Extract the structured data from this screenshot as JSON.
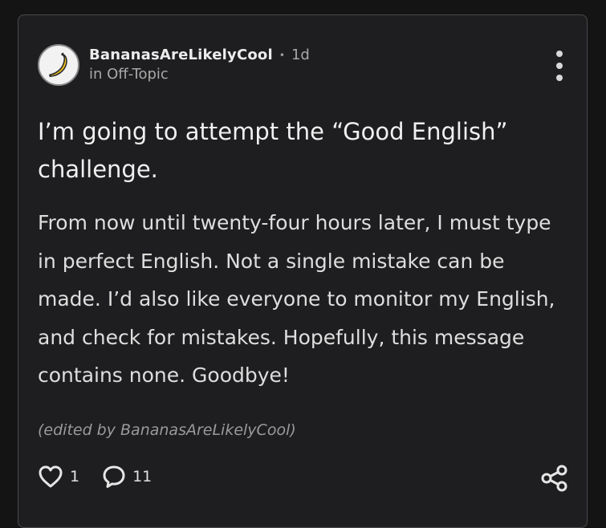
{
  "post": {
    "author": "BananasAreLikelyCool",
    "separator": "•",
    "time": "1d",
    "category": "in Off-Topic",
    "title": "I’m going to attempt the “Good English” challenge.",
    "body": "From now until twenty-four hours later, I must type in perfect English. Not a single mistake can be made. I’d also like everyone to monitor my English, and check for mistakes. Hopefully, this message contains none. Goodbye!",
    "edited_note": "(edited by BananasAreLikelyCool)"
  },
  "actions": {
    "likes": "1",
    "comments": "11"
  },
  "icons": {
    "avatar": "banana-icon",
    "more": "more-vertical-icon",
    "like": "heart-icon",
    "comment": "comment-icon",
    "share": "share-icon"
  },
  "colors": {
    "background": "#141414",
    "card": "#1e1e20",
    "text": "#e9e9e9",
    "muted": "#a8a8a8"
  }
}
